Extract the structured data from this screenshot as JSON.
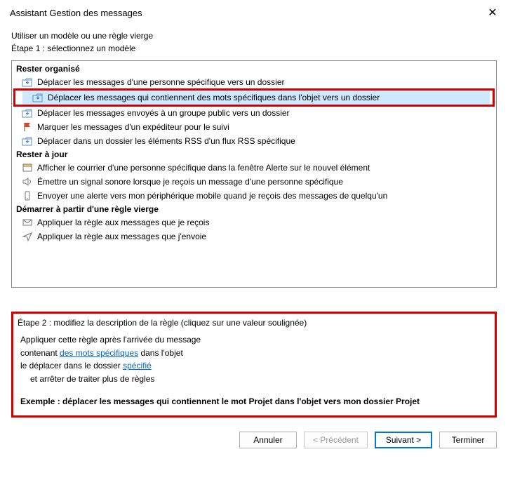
{
  "window": {
    "title": "Assistant Gestion des messages",
    "close_glyph": "✕"
  },
  "intro": {
    "line1": "Utiliser un modèle ou une règle vierge",
    "line2": "Étape 1 : sélectionnez un modèle"
  },
  "groups": {
    "g1": {
      "header": "Rester organisé",
      "r1": "Déplacer les messages d'une personne spécifique vers un dossier",
      "r2": "Déplacer les messages qui contiennent des mots spécifiques dans l'objet vers un dossier",
      "r3": "Déplacer les messages envoyés à un groupe public vers un dossier",
      "r4": "Marquer les messages d'un expéditeur pour le suivi",
      "r5": "Déplacer dans un dossier les éléments RSS d'un flux RSS spécifique"
    },
    "g2": {
      "header": "Rester à jour",
      "r1": "Afficher le courrier d'une personne spécifique dans la fenêtre Alerte sur le nouvel élément",
      "r2": "Émettre un signal sonore lorsque je reçois un message d'une personne spécifique",
      "r3": "Envoyer une alerte vers mon périphérique mobile quand je reçois des messages de quelqu'un"
    },
    "g3": {
      "header": "Démarrer à partir d'une règle vierge",
      "r1": "Appliquer la règle aux messages que je reçois",
      "r2": "Appliquer la règle aux messages que j'envoie"
    }
  },
  "step2": {
    "title": "Étape 2 : modifiez la description de la règle (cliquez sur une valeur soulignée)",
    "line1": "Appliquer cette règle après l'arrivée du message",
    "line2_pre": "contenant ",
    "line2_link": "des mots spécifiques",
    "line2_post": " dans l'objet",
    "line3_pre": "le déplacer dans le dossier ",
    "line3_link": "spécifié",
    "line4": "et arrêter de traiter plus de règles",
    "example": "Exemple : déplacer les messages qui contiennent le mot Projet dans l'objet vers mon dossier Projet"
  },
  "buttons": {
    "cancel": "Annuler",
    "back": "< Précédent",
    "next": "Suivant >",
    "finish": "Terminer"
  }
}
